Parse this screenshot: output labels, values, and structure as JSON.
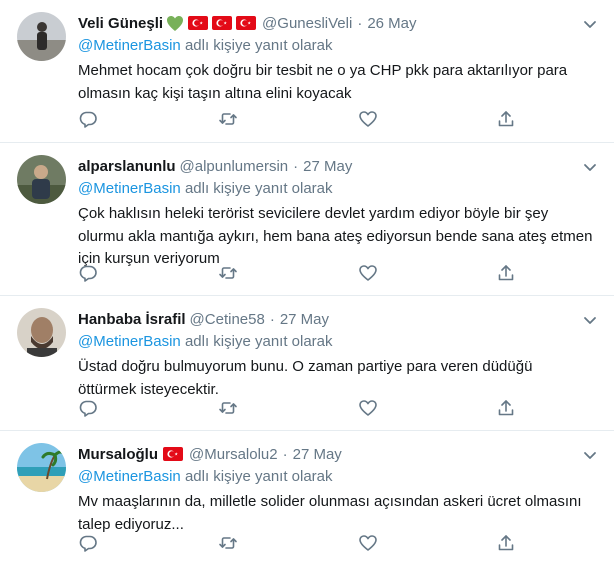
{
  "tweets": [
    {
      "name": "Veli Güneşli",
      "handle": "@GunesliVeli",
      "separator": "·",
      "date": "26 May",
      "name_emojis": [
        "green-heart-icon",
        "turkish-flag-icon",
        "turkish-flag-icon",
        "turkish-flag-icon"
      ],
      "reply_mention": "@MetinerBasin",
      "reply_suffix": "adlı kişiye yanıt olarak",
      "text": "Mehmet hocam çok doğru bir tesbit ne o ya CHP pkk para aktarılıyor para olmasın kaç kişi taşın altına elini koyacak"
    },
    {
      "name": "alparslanunlu",
      "handle": "@alpunlumersin",
      "separator": "·",
      "date": "27 May",
      "name_emojis": [],
      "reply_mention": "@MetinerBasin",
      "reply_suffix": "adlı kişiye yanıt olarak",
      "text": "Çok haklısın heleki terörist sevicilere devlet yardım ediyor böyle bir şey olurmu akla mantığa aykırı, hem bana ateş ediyorsun bende sana ateş etmen için kurşun veriyorum"
    },
    {
      "name": "Hanbaba İsrafil",
      "handle": "@Cetine58",
      "separator": "·",
      "date": "27 May",
      "name_emojis": [],
      "reply_mention": "@MetinerBasin",
      "reply_suffix": "adlı kişiye yanıt olarak",
      "text": "Üstad doğru bulmuyorum bunu. O zaman partiye para veren düdüğü öttürmek isteyecektir."
    },
    {
      "name": "Mursaloğlu",
      "handle": "@Mursalolu2",
      "separator": "·",
      "date": "27 May",
      "name_emojis": [
        "turkish-flag-icon"
      ],
      "reply_mention": "@MetinerBasin",
      "reply_suffix": "adlı kişiye yanıt olarak",
      "text": "Mv maaşlarının da, milletle solider olunması açısından askeri ücret olmasını talep ediyoruz..."
    }
  ],
  "icons": {
    "reply": "reply-icon",
    "retweet": "retweet-icon",
    "like": "heart-icon",
    "share": "share-icon",
    "menu": "chevron-down-icon"
  },
  "colors": {
    "secondary_text": "#657786",
    "link": "#1b95e0",
    "icon": "#657786",
    "divider": "#e6ecf0",
    "flag_red": "#e30a17",
    "heart_green": "#78b159"
  }
}
